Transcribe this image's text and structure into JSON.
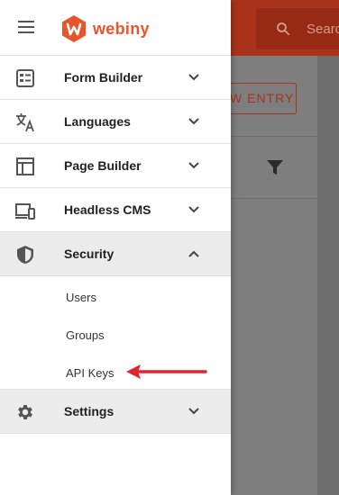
{
  "background": {
    "search_placeholder": "Search",
    "new_entry_button": "W ENTRY"
  },
  "brand": {
    "name": "webiny",
    "color": "#e8552b"
  },
  "menu": {
    "items": [
      {
        "label": "Form Builder",
        "icon": "form-builder-icon",
        "expanded": false
      },
      {
        "label": "Languages",
        "icon": "translate-icon",
        "expanded": false
      },
      {
        "label": "Page Builder",
        "icon": "page-layout-icon",
        "expanded": false
      },
      {
        "label": "Headless CMS",
        "icon": "devices-icon",
        "expanded": false
      },
      {
        "label": "Security",
        "icon": "shield-icon",
        "expanded": true
      },
      {
        "label": "Settings",
        "icon": "gear-icon",
        "expanded": false
      }
    ],
    "security_subitems": [
      "Users",
      "Groups",
      "API Keys"
    ]
  },
  "annotation": {
    "arrow_color": "#e0242b",
    "points_to": "API Keys"
  }
}
